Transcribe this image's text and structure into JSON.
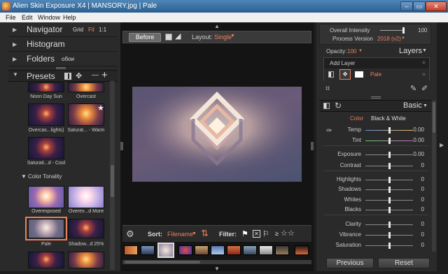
{
  "window": {
    "title": "Alien Skin Exposure X4 | MANSORY.jpg | Pale",
    "minimize": "‒",
    "maximize": "▭",
    "close": "✕"
  },
  "menu": {
    "file": "File",
    "edit": "Edit",
    "window": "Window",
    "help": "Help"
  },
  "left": {
    "navigator": "Navigator",
    "navigator_grid": "Grid",
    "navigator_fit": "Fit",
    "navigator_1to1": "1:1",
    "histogram": "Histogram",
    "folders": "Folders",
    "folders_value": "обои",
    "presets": "Presets",
    "add_icon": "+",
    "minus_icon": "—",
    "group_color_tonality": "Color Tonality",
    "preset_labels": {
      "noon_day_sun": "Noon Day Sun",
      "overcast": "Overcast",
      "overcast_lights": "Overcas...lights)",
      "saturated_warm": "Saturat... - Warm",
      "saturated_cool": "Saturati...d - Cool",
      "overexposed": "Overexposed",
      "overexposed_more": "Overex...d More",
      "pale": "Pale",
      "shadows_25": "Shadow...d 25%"
    }
  },
  "center": {
    "before_label": "Before",
    "layout_label": "Layout:",
    "layout_value": "Single",
    "sort_label": "Sort:",
    "sort_value": "Filename",
    "filter_label": "Filter:",
    "filter_ge": "≥"
  },
  "right": {
    "overall_intensity_label": "Overall Intensity",
    "overall_intensity_value": "100",
    "process_version_label": "Process Version",
    "process_version_value": "2018 (v2)",
    "opacity_label": "Opacity:",
    "opacity_value": "100",
    "layers_label": "Layers",
    "add_layer": "Add Layer",
    "layer_name": "Pale",
    "basic_label": "Basic",
    "tab_color": "Color",
    "tab_bw": "Black & White",
    "sliders": [
      {
        "label": "Temp",
        "value": "0.00"
      },
      {
        "label": "Tint",
        "value": "0.00"
      },
      {
        "label": "Exposure",
        "value": "0.00"
      },
      {
        "label": "Contrast",
        "value": "0"
      },
      {
        "label": "Highlights",
        "value": "0"
      },
      {
        "label": "Shadows",
        "value": "0"
      },
      {
        "label": "Whites",
        "value": "0"
      },
      {
        "label": "Blacks",
        "value": "0"
      },
      {
        "label": "Clarity",
        "value": "0"
      },
      {
        "label": "Vibrance",
        "value": "0"
      },
      {
        "label": "Saturation",
        "value": "0"
      }
    ],
    "previous_label": "Previous",
    "reset_label": "Reset"
  },
  "colors": {
    "accent": "#e8805c",
    "panel": "#2a2a2a",
    "background": "#1d1d1d"
  }
}
